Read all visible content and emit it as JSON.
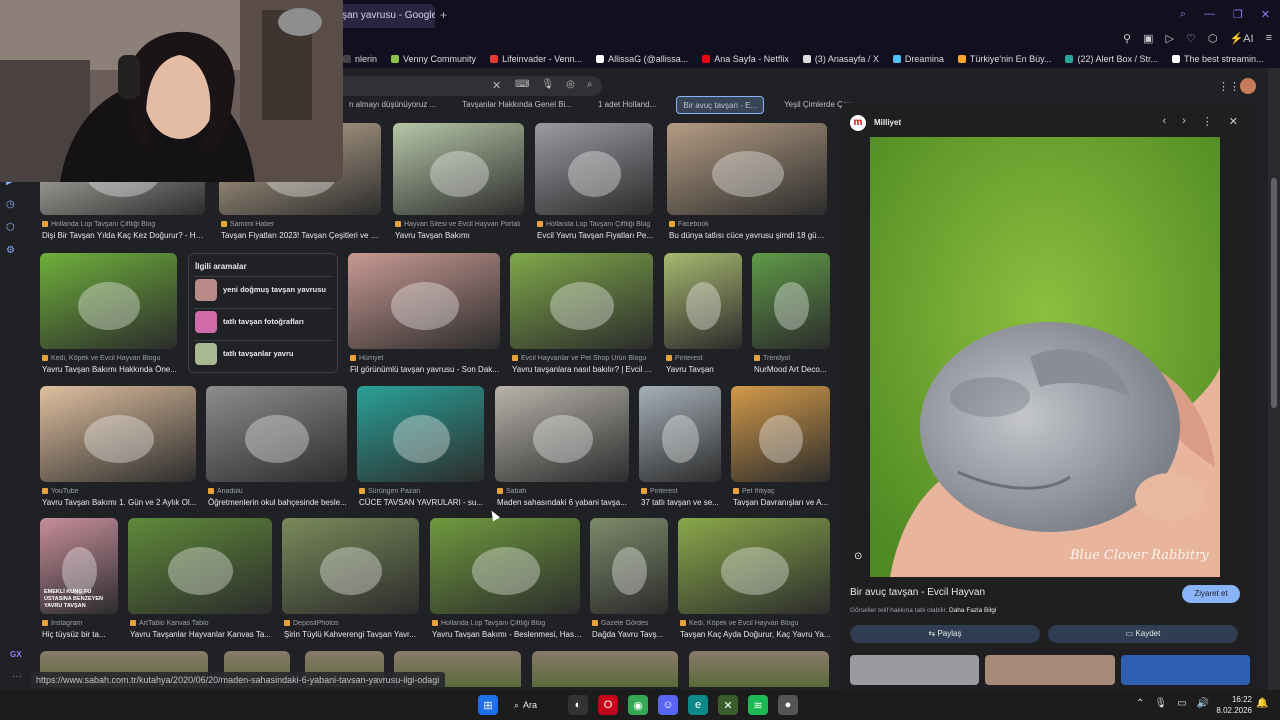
{
  "browser": {
    "active_tab_title": "şan yavrusu - Google'd",
    "new_tab": "+",
    "toolbar_ai": "AI"
  },
  "bookmarks": [
    {
      "label": "nlerin",
      "color": "#444"
    },
    {
      "label": "Venny Community",
      "color": "#8bc34a"
    },
    {
      "label": "Lifeinvader - Venn...",
      "color": "#e53935"
    },
    {
      "label": "AllissaG (@allissa...",
      "color": "#ffffff"
    },
    {
      "label": "Ana Sayfa - Netflix",
      "color": "#e50914"
    },
    {
      "label": "(3) Anasayfa / X",
      "color": "#dddddd"
    },
    {
      "label": "Dreamina",
      "color": "#4fc3f7"
    },
    {
      "label": "Türkiye'nin En Büy...",
      "color": "#f9a825"
    },
    {
      "label": "(22) Alert Box / Str...",
      "color": "#26a69a"
    },
    {
      "label": "The best streamin...",
      "color": "#ffffff"
    }
  ],
  "chips": [
    {
      "label": "n almayı düşünüyoruz ...",
      "selected": false
    },
    {
      "label": "Tavşanlar Hakkında Genel Bi...",
      "selected": false
    },
    {
      "label": "1 adet Holland...",
      "selected": false
    },
    {
      "label": "Bir avuç tavşan - E...",
      "selected": true
    },
    {
      "label": "Yeşil Çimlerde Çay...",
      "selected": false
    }
  ],
  "results": [
    {
      "source": "Hollanda Lop Tavşanı Çiftliği Blog",
      "title": "Dişi Bir Tavşan Yılda Kaç Kez Doğurur? - Hol...",
      "color": "#d8d4cc"
    },
    {
      "source": "Samimi Haber",
      "title": "Tavşan Fiyatları 2023! Tavşan Çeşitleri ve Fi...",
      "color": "#c8b49a"
    },
    {
      "source": "Hayvan Sitesi ve Evcil Hayvan Portalı",
      "title": "Yavru Tavşan Bakımı",
      "color": "#b7c7a8"
    },
    {
      "source": "Hollanda Lop Tavşanı Çiftliği Blog",
      "title": "Evcil Yavru Tavşan Fiyatları Pe...",
      "color": "#9a9aa2"
    },
    {
      "source": "Facebook",
      "title": "Bu dünya tatlısı cüce yavrusu şimdi 18 günlü...",
      "color": "#b49c84"
    },
    {
      "source": "Kedi, Köpek ve Evcil Hayvan Blogu",
      "title": "Yavru Tavşan Bakımı Hakkında Öne...",
      "color": "#6fb03c"
    },
    {
      "source": "Hürriyet",
      "title": "Fil görünümlü tavşan yavrusu - Son Dak...",
      "color": "#c99a94"
    },
    {
      "source": "Evcil Hayvanlar ve Pet Shop Ürün Blogu",
      "title": "Yavru tavşanlara nasıl bakılır? | Evcil ...",
      "color": "#7fa84a"
    },
    {
      "source": "Pinterest",
      "title": "Yavru Tavşan",
      "color": "#a8b870"
    },
    {
      "source": "Trendyol",
      "title": "NurMood Art Deco...",
      "color": "#5f9a48"
    },
    {
      "source": "YouTube",
      "title": "Yavru Tavşan Bakımı 1. Gün ve 2 Aylık Ol...",
      "color": "#e0c0a0"
    },
    {
      "source": "Anadolu",
      "title": "Öğretmenlerin okul bahçesinde besle...",
      "color": "#8d8d8d"
    },
    {
      "source": "Sürüngen Pazarı",
      "title": "CÜCE TAVSAN YAVRULARI - su...",
      "color": "#2aa198"
    },
    {
      "source": "Sabah",
      "title": "Maden sahasındaki 6 yabani tavşa...",
      "color": "#b8b4ac"
    },
    {
      "source": "Pinterest",
      "title": "37 tatlı tavşan ve se...",
      "color": "#a6b0b8"
    },
    {
      "source": "Pet İhtiyaç",
      "title": "Tavşan Davranışları ve A...",
      "color": "#d39a4a"
    },
    {
      "source": "Instagram",
      "title": "Hiç tüysüz bir ta...",
      "color": "#c78e9c"
    },
    {
      "source": "ArtTablo Kanvas Tablo",
      "title": "Yavru Tavşanlar Hayvanlar Kanvas Ta...",
      "color": "#5f8a3a"
    },
    {
      "source": "DepositPhotos",
      "title": "Şirin Tüylü Kahverengi Tavşan Yavr...",
      "color": "#7a8a5a"
    },
    {
      "source": "Hollanda Lop Tavşanı Çiftliği Blog",
      "title": "Yavru Tavşan Bakımı - Beslenmesi, Hast...",
      "color": "#6f9a3e"
    },
    {
      "source": "Gazete Gördes",
      "title": "Dağda Yavru Tavş...",
      "color": "#7d8a6a"
    },
    {
      "source": "Kedi, Köpek ve Evcil Hayvan Blogu",
      "title": "Tavşan Kaç Ayda Doğurur, Kaç Yavru Ya...",
      "color": "#8aa84a"
    }
  ],
  "instagram_overlay": "EMEKLİ KUNG FU USTASINA BENZEYEN YAVRU TAVŞAN",
  "related": {
    "heading": "İlgili aramalar",
    "items": [
      {
        "label": "yeni doğmuş tavşan yavrusu",
        "color": "#b98a8a"
      },
      {
        "label": "tatlı tavşan fotoğrafları",
        "color": "#d06aa8"
      },
      {
        "label": "tatlı tavşanlar yavru",
        "color": "#a8b890"
      }
    ]
  },
  "preview": {
    "site": "Milliyet",
    "title": "Bir avuç tavşan - Evcil Hayvan",
    "visit": "Ziyaret et",
    "note": "Görseller telif hakkına tabi olabilir.",
    "note_link": "Daha Fazla Bilgi",
    "share": "Paylaş",
    "save": "Kaydet",
    "watermark": "Blue Clover Rabbitry"
  },
  "status_url": "https://www.sabah.com.tr/kutahya/2020/06/20/maden-sahasindaki-6-yabani-tavsan-yavrusu-ilgi-odagi",
  "left_rail_label": "GX",
  "taskbar": {
    "search": "Ara",
    "time": "16:22",
    "date": "8.02.2026"
  }
}
